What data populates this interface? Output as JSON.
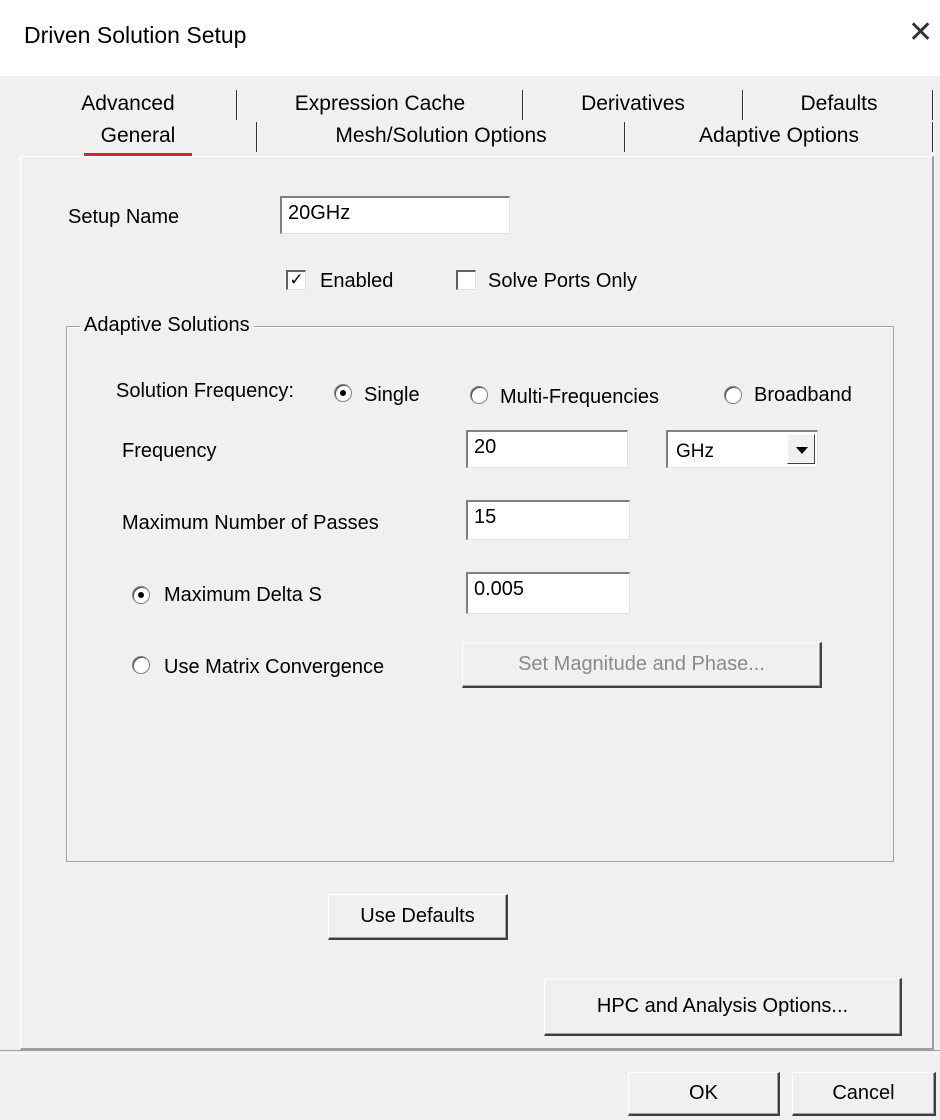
{
  "window": {
    "title": "Driven Solution Setup",
    "close_glyph": "✕"
  },
  "tabs": {
    "row_back": [
      "Advanced",
      "Expression Cache",
      "Derivatives",
      "Defaults"
    ],
    "row_front": [
      "General",
      "Mesh/Solution Options",
      "Adaptive Options"
    ],
    "active": "General"
  },
  "general": {
    "setup_name_label": "Setup Name",
    "setup_name_value": "20GHz",
    "enabled_label": "Enabled",
    "enabled_checked": true,
    "solve_ports_only_label": "Solve Ports Only",
    "solve_ports_only_checked": false
  },
  "adaptive": {
    "group_title": "Adaptive Solutions",
    "solution_frequency_label": "Solution Frequency:",
    "freq_options": [
      "Single",
      "Multi-Frequencies",
      "Broadband"
    ],
    "freq_selected": "Single",
    "frequency_label": "Frequency",
    "frequency_value": "20",
    "frequency_unit": "GHz",
    "max_passes_label": "Maximum Number of Passes",
    "max_passes_value": "15",
    "max_delta_s_label": "Maximum Delta S",
    "max_delta_s_value": "0.005",
    "matrix_convergence_label": "Use Matrix Convergence",
    "set_mag_phase_label": "Set Magnitude and Phase...",
    "convergence_selected": "Maximum Delta S"
  },
  "buttons": {
    "use_defaults": "Use Defaults",
    "hpc": "HPC and Analysis Options...",
    "ok": "OK",
    "cancel": "Cancel"
  },
  "colors": {
    "active_tab_underline": "#d8222a",
    "dialog_bg": "#f0f0f0"
  }
}
